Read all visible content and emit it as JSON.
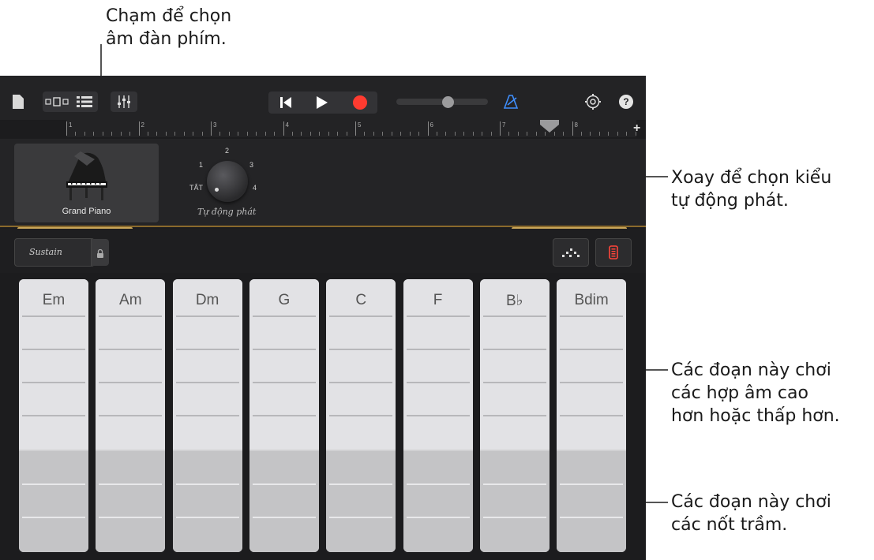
{
  "callouts": {
    "top": "Chạm để chọn\nâm đàn phím.",
    "knob": "Xoay để chọn kiểu\ntự động phát.",
    "upper": "Các đoạn này chơi\ncác hợp âm cao\nhơn hoặc thấp hơn.",
    "lower": "Các đoạn này chơi\ncác nốt trầm."
  },
  "ruler": {
    "bars": [
      "1",
      "2",
      "3",
      "4",
      "5",
      "6",
      "7",
      "8"
    ],
    "add_label": "+"
  },
  "instrument": {
    "name": "Grand Piano"
  },
  "autoplay": {
    "positions": [
      "TẮT",
      "1",
      "2",
      "3",
      "4"
    ],
    "label": "Tự động phát",
    "selected": "TẮT"
  },
  "controls": {
    "sustain_label": "Sustain"
  },
  "chords": [
    "Em",
    "Am",
    "Dm",
    "G",
    "C",
    "F",
    "B♭",
    "Bdim"
  ],
  "colors": {
    "record": "#ff3b30",
    "metronome": "#3f8efc",
    "gold": "#c8a55a",
    "accent_red": "#ff453a"
  },
  "icons": [
    "document-icon",
    "view-toggle-icon",
    "tracks-view-icon",
    "mixer-icon",
    "rewind-icon",
    "play-icon",
    "record-icon",
    "metronome-icon",
    "settings-icon",
    "help-icon",
    "lock-icon",
    "arpeggiator-icon",
    "remote-icon",
    "piano-icon"
  ]
}
